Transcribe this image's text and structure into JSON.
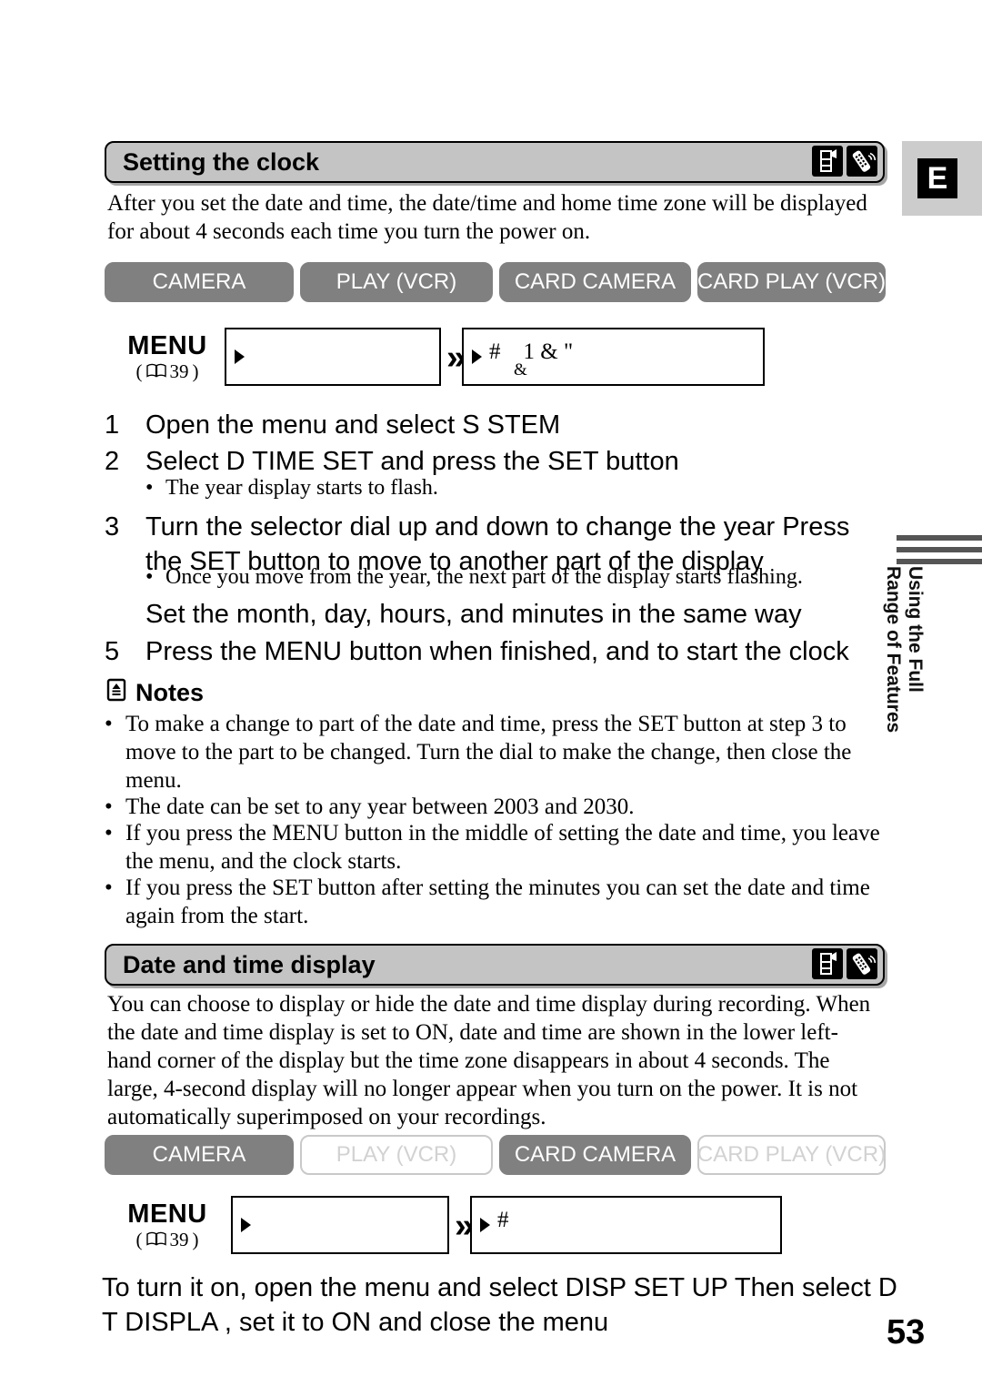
{
  "language_tab": {
    "label": "E"
  },
  "side_caption": {
    "line1": "Using the Full",
    "line2": "Range of Features"
  },
  "page_number": "53",
  "sections": [
    {
      "id": "setting-the-clock",
      "title": "Setting the clock",
      "icons": [
        "camcorder-icon",
        "remote-control-icon"
      ],
      "intro": "After you set the date and time, the date/time and home time zone will be displayed for about 4 seconds each time you turn the power on.",
      "modes": [
        {
          "label": "CAMERA",
          "state": "on"
        },
        {
          "label": "PLAY (VCR)",
          "state": "on"
        },
        {
          "label": "CARD CAMERA",
          "state": "on"
        },
        {
          "label": "CARD PLAY (VCR)",
          "state": "on"
        }
      ],
      "menu": {
        "label": "MENU",
        "ref_open": "(",
        "ref_page": "39",
        "ref_close": ")",
        "box1_text": "",
        "box2_text": "#    1 & \"",
        "box2_sub": "&",
        "separator": "»"
      },
      "steps": [
        {
          "num": "1",
          "text": "Open the menu and select S  STEM"
        },
        {
          "num": "2",
          "text": "Select D TIME SET and press the SET button",
          "sub": "The year display starts to flash."
        },
        {
          "num": "3",
          "text": "Turn the selector dial up and down to change the year  Press the SET button to move to another part of the display",
          "sub": "Once you move from the year, the next part of the display starts flashing."
        },
        {
          "num": "",
          "text": "Set the month, day, hours, and minutes in the same way"
        },
        {
          "num": "5",
          "text": "Press the MENU button when finished, and to start the clock"
        }
      ],
      "notes": {
        "heading": "Notes",
        "icon": "note-book-icon",
        "items": [
          "To make a change to part of the date and time, press the SET button at step 3 to move to the part to be changed. Turn the dial to make the change, then close the menu.",
          "The date can be set to any year between 2003 and 2030.",
          "If you press the MENU button in the middle of setting the date and time, you leave the menu, and the clock starts.",
          "If you press the SET button after setting the minutes you can set the date and time again from the start."
        ]
      }
    },
    {
      "id": "date-and-time-display",
      "title": "Date and time display",
      "icons": [
        "camcorder-icon",
        "remote-control-icon"
      ],
      "intro": "You can choose to display or hide the date and time display during recording. When the date and time display is set to ON, date and time are shown in the lower left-hand corner of the display but the time zone disappears in about 4 seconds. The large, 4-second display will no longer appear when you turn on the power. It is not automatically superimposed on your recordings.",
      "modes": [
        {
          "label": "CAMERA",
          "state": "on"
        },
        {
          "label": "PLAY (VCR)",
          "state": "off"
        },
        {
          "label": "CARD CAMERA",
          "state": "on"
        },
        {
          "label": "CARD PLAY (VCR)",
          "state": "off"
        }
      ],
      "menu": {
        "label": "MENU",
        "ref_open": "(",
        "ref_page": "39",
        "ref_close": ")",
        "box1_text": "",
        "box2_text": "#",
        "box2_sub": "",
        "separator": "»"
      },
      "closing": "To turn it on, open the menu and select DISP SET UP  Then select D T DISPLA , set it to ON and close the menu"
    }
  ]
}
